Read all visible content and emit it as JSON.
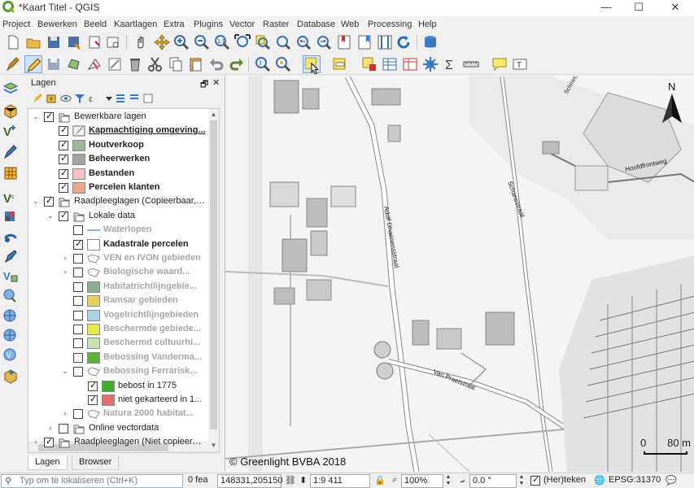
{
  "window": {
    "title": "*Kaart Titel - QGIS"
  },
  "menu": [
    "Project",
    "Bewerken",
    "Beeld",
    "Kaartlagen",
    "Extra",
    "Plugins",
    "Vector",
    "Raster",
    "Database",
    "Web",
    "Processing",
    "Help"
  ],
  "panel": {
    "title": "Lagen",
    "tabs": [
      "Lagen",
      "Browser"
    ]
  },
  "layers": [
    {
      "label": "Bewerkbare lagen",
      "level": 0,
      "expand": "open",
      "checked": true,
      "kind": "group"
    },
    {
      "label": "Kapmachtiging omgeving...",
      "level": 1,
      "checked": true,
      "kind": "editing",
      "style": "bu"
    },
    {
      "label": "Houtverkoop",
      "level": 1,
      "checked": true,
      "kind": "fill",
      "color": "#9fb59c",
      "style": "b"
    },
    {
      "label": "Beheerwerken",
      "level": 1,
      "checked": true,
      "kind": "fill",
      "color": "#9aa79a",
      "style": "b"
    },
    {
      "label": "Bestanden",
      "level": 1,
      "checked": true,
      "kind": "fill",
      "color": "#f2c3c3",
      "style": "b"
    },
    {
      "label": "Percelen klanten",
      "level": 1,
      "checked": true,
      "kind": "fill",
      "color": "#e8a98b",
      "style": "b"
    },
    {
      "label": "Raadpleeglagen (Copieerbaar, l...",
      "level": 0,
      "expand": "open",
      "checked": true,
      "kind": "group"
    },
    {
      "label": "Lokale data",
      "level": 1,
      "expand": "open",
      "checked": true,
      "kind": "group"
    },
    {
      "label": "Waterlopen",
      "level": 2,
      "checked": false,
      "kind": "line",
      "color": "#8fb0d8",
      "style": "dis"
    },
    {
      "label": "Kadastrale percelen",
      "level": 2,
      "checked": true,
      "kind": "fill",
      "color": "#ffffff",
      "style": "b"
    },
    {
      "label": "VEN en IVON gebieden",
      "level": 2,
      "expand": "closed",
      "checked": false,
      "kind": "polygroup",
      "style": "dis"
    },
    {
      "label": "Biologische waard...",
      "level": 2,
      "expand": "closed",
      "checked": false,
      "kind": "polygroup",
      "style": "dis"
    },
    {
      "label": "Habitatrichtlijngebie...",
      "level": 2,
      "checked": false,
      "kind": "fill",
      "color": "#8fb08f",
      "style": "dis"
    },
    {
      "label": "Ramsar gebieden",
      "level": 2,
      "checked": false,
      "kind": "fill",
      "color": "#e5d15a",
      "style": "dis"
    },
    {
      "label": "Vogelrichtlijngebieden",
      "level": 2,
      "checked": false,
      "kind": "fill",
      "color": "#a9d4e6",
      "style": "dis"
    },
    {
      "label": "Beschermde gebiede...",
      "level": 2,
      "checked": false,
      "kind": "fill",
      "color": "#e8e84a",
      "style": "dis"
    },
    {
      "label": "Beschermd cultuurhi...",
      "level": 2,
      "checked": false,
      "kind": "fill",
      "color": "#c7e3b4",
      "style": "dis"
    },
    {
      "label": "Bebossing Vanderma...",
      "level": 2,
      "checked": false,
      "kind": "fill",
      "color": "#59b43a",
      "style": "dis"
    },
    {
      "label": "Bebossing Ferrarisk...",
      "level": 2,
      "expand": "open",
      "checked": false,
      "kind": "polygroup",
      "style": "dis"
    },
    {
      "label": "bebost in 1775",
      "level": 3,
      "checked": true,
      "kind": "fill",
      "color": "#3fae2a",
      "style": ""
    },
    {
      "label": "niet gekarteerd in 1...",
      "level": 3,
      "checked": true,
      "kind": "fill",
      "color": "#e07070",
      "style": ""
    },
    {
      "label": "Natura 2000 habitat...",
      "level": 2,
      "expand": "closed",
      "checked": false,
      "kind": "polygroup",
      "style": "dis"
    },
    {
      "label": "Online vectordata",
      "level": 1,
      "expand": "closed",
      "checked": false,
      "kind": "group"
    },
    {
      "label": "Raadpleeglagen (Niet copieerba...",
      "level": 0,
      "expand": "closed",
      "checked": true,
      "kind": "group"
    }
  ],
  "map": {
    "copyright": "© Greenlight BVBA 2018",
    "scale_zero": "0",
    "scale_value": "80 m",
    "north_label": "N",
    "streets": [
      "Adolf Dhaenensstraat",
      "Van Praetstraat",
      "Schansstraat",
      "Hoofdfrontweg",
      "Schmetslaan"
    ]
  },
  "status": {
    "locator_placeholder": "Typ om te lokaliseren (Ctrl+K)",
    "coord_label": "0 fea",
    "coordinate": "148331,205150",
    "scale": "1:9 411",
    "magnifier": "100%",
    "rotation": "0.0 °",
    "render_label": "(Her)teken",
    "crs": "EPSG:31370"
  }
}
